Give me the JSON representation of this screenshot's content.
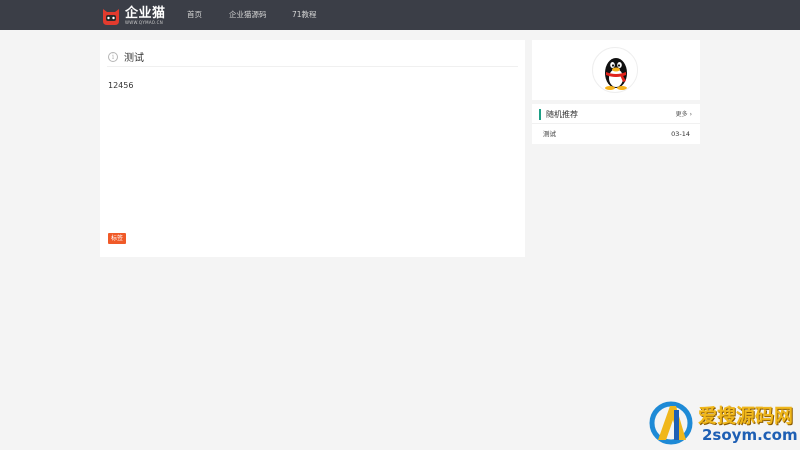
{
  "header": {
    "logo_title": "企业猫",
    "logo_subtitle": "WWW.QYMAO.CN",
    "nav": [
      "首页",
      "企业猫源码",
      "71教程"
    ]
  },
  "article": {
    "title": "测试",
    "body": "12456",
    "tag": "标签"
  },
  "sidebar": {
    "recommend_title": "随机推荐",
    "more_label": "更多",
    "items": [
      {
        "title": "测试",
        "date": "03-14"
      }
    ]
  },
  "watermark": {
    "text_cn": "爱搜源码网",
    "text_en": "2soym.com"
  },
  "colors": {
    "topbar": "#3b3e47",
    "accent_green": "#1e9f86",
    "tag_orange": "#f05a28",
    "background": "#f4f4f4"
  }
}
